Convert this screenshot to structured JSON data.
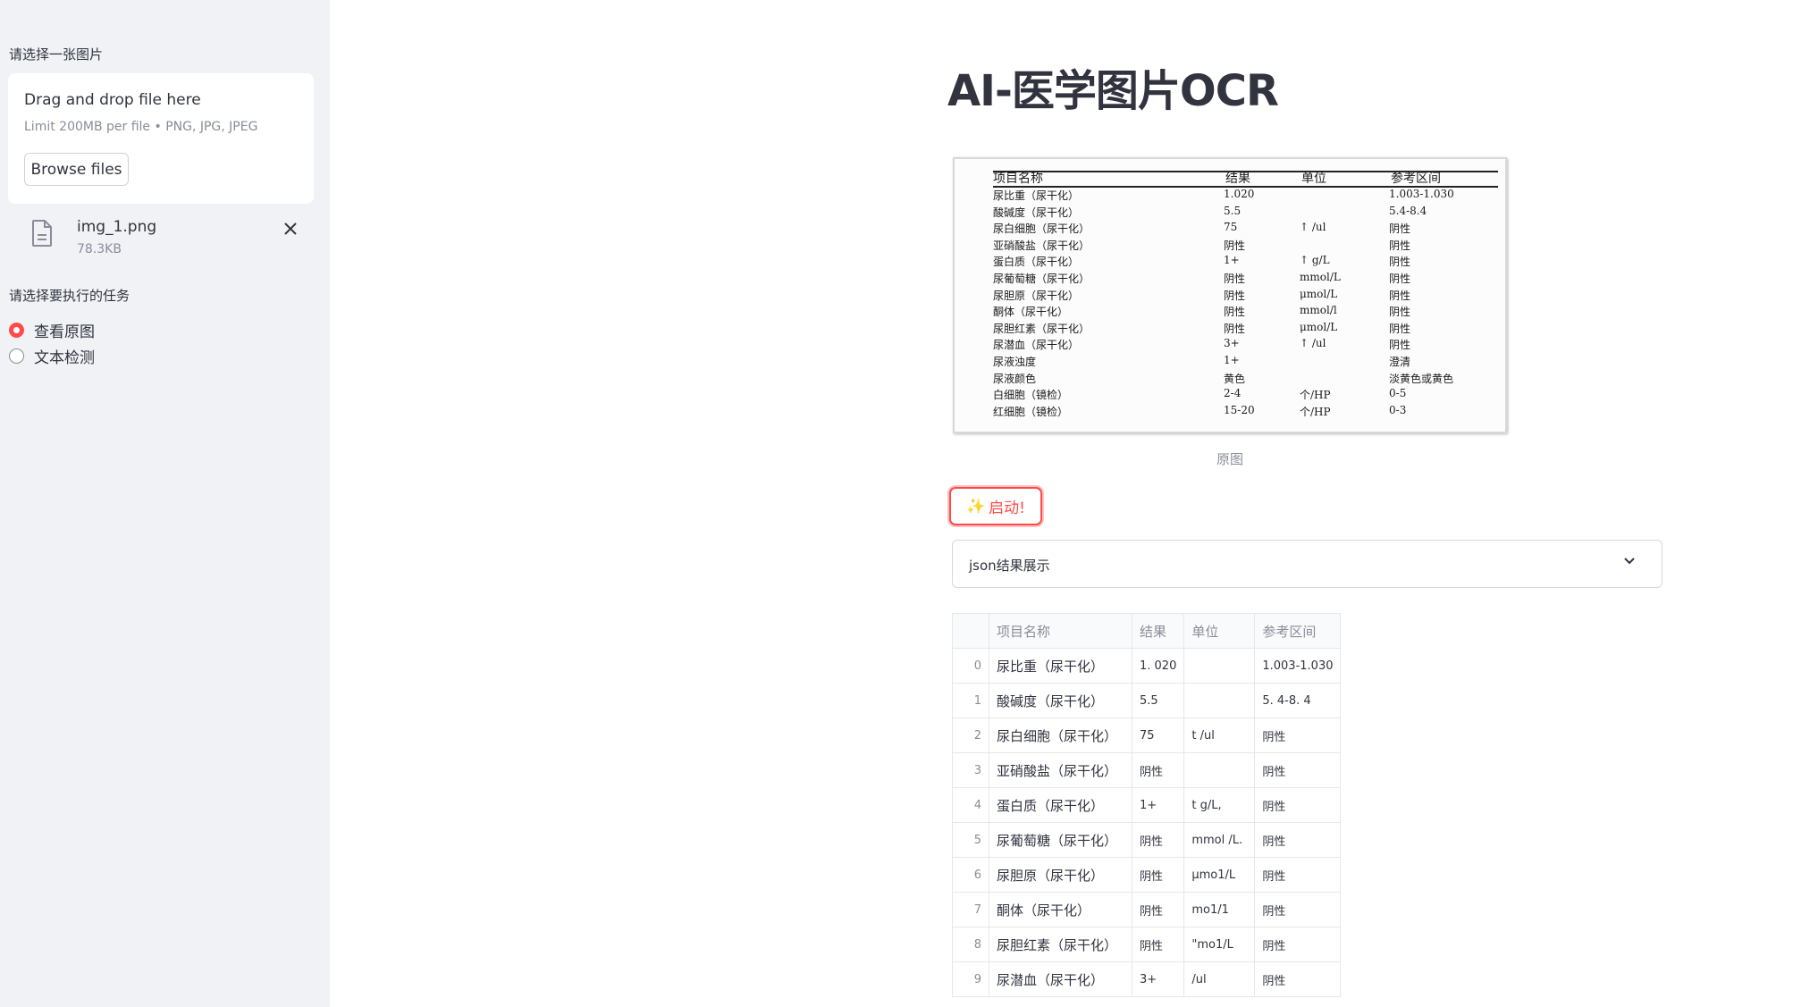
{
  "sidebar": {
    "upload_label": "请选择一张图片",
    "drop_title": "Drag and drop file here",
    "drop_limit": "Limit 200MB per file • PNG, JPG, JPEG",
    "browse_label": "Browse files",
    "file": {
      "name": "img_1.png",
      "size": "78.3KB",
      "icon": "file-icon",
      "close_icon": "close-icon"
    },
    "task_label": "请选择要执行的任务",
    "tasks": [
      {
        "label": "查看原图",
        "selected": true
      },
      {
        "label": "文本检测",
        "selected": false
      }
    ]
  },
  "main": {
    "title": "AI-医学图片OCR",
    "image_caption": "原图",
    "start_button": "启动!",
    "start_icon": "sparkle-icon",
    "expander_label": "json结果展示",
    "expander_icon": "chevron-down-icon"
  },
  "document": {
    "headers": [
      "项目名称",
      "结果",
      "单位",
      "参考区间"
    ],
    "rows": [
      [
        "尿比重（尿干化）",
        "1.020",
        "",
        "1.003-1.030"
      ],
      [
        "酸碱度（尿干化）",
        "5.5",
        "",
        "5.4-8.4"
      ],
      [
        "尿白细胞（尿干化）",
        "75",
        "↑ /ul",
        "阴性"
      ],
      [
        "亚硝酸盐（尿干化）",
        "阴性",
        "",
        "阴性"
      ],
      [
        "蛋白质（尿干化）",
        "1+",
        "↑ g/L",
        "阴性"
      ],
      [
        "尿葡萄糖（尿干化）",
        "阴性",
        "mmol/L",
        "阴性"
      ],
      [
        "尿胆原（尿干化）",
        "阴性",
        "μmol/L",
        "阴性"
      ],
      [
        "酮体（尿干化）",
        "阴性",
        "mmol/l",
        "阴性"
      ],
      [
        "尿胆红素（尿干化）",
        "阴性",
        "μmol/L",
        "阴性"
      ],
      [
        "尿潜血（尿干化）",
        "3+",
        "↑ /ul",
        "阴性"
      ],
      [
        "尿液浊度",
        "1+",
        "",
        "澄清"
      ],
      [
        "尿液颜色",
        "黄色",
        "",
        "淡黄色或黄色"
      ],
      [
        "白细胞（镜检）",
        "2-4",
        "个/HP",
        "0-5"
      ],
      [
        "红细胞（镜检）",
        "15-20",
        "个/HP",
        "0-3"
      ]
    ]
  },
  "table": {
    "headers": [
      "",
      "项目名称",
      "结果",
      "单位",
      "参考区间"
    ],
    "rows": [
      [
        "0",
        "尿比重（尿干化）",
        "1. 020",
        "",
        "1.003-1.030"
      ],
      [
        "1",
        "酸碱度（尿干化）",
        "5.5",
        "",
        "5. 4-8. 4"
      ],
      [
        "2",
        "尿白细胞（尿干化）",
        "75",
        "t /ul",
        "阴性"
      ],
      [
        "3",
        "亚硝酸盐（尿干化）",
        "阴性",
        "",
        "阴性"
      ],
      [
        "4",
        "蛋白质（尿干化）",
        "1+",
        "t g/L,",
        "阴性"
      ],
      [
        "5",
        "尿葡萄糖（尿干化）",
        "阴性",
        "mmol /L.",
        "阴性"
      ],
      [
        "6",
        "尿胆原（尿干化）",
        "阴性",
        "μmo1/L",
        "阴性"
      ],
      [
        "7",
        "酮体（尿干化）",
        "阴性",
        "mo1/1",
        "阴性"
      ],
      [
        "8",
        "尿胆红素（尿干化）",
        "阴性",
        "\"mo1/L",
        "阴性"
      ],
      [
        "9",
        "尿潜血（尿干化）",
        "3+",
        "/ul",
        "阴性"
      ]
    ]
  },
  "colors": {
    "accent": "#ff4b4b",
    "sidebar_bg": "#f0f2f6",
    "text": "#31333f",
    "muted": "#8a8d99"
  }
}
